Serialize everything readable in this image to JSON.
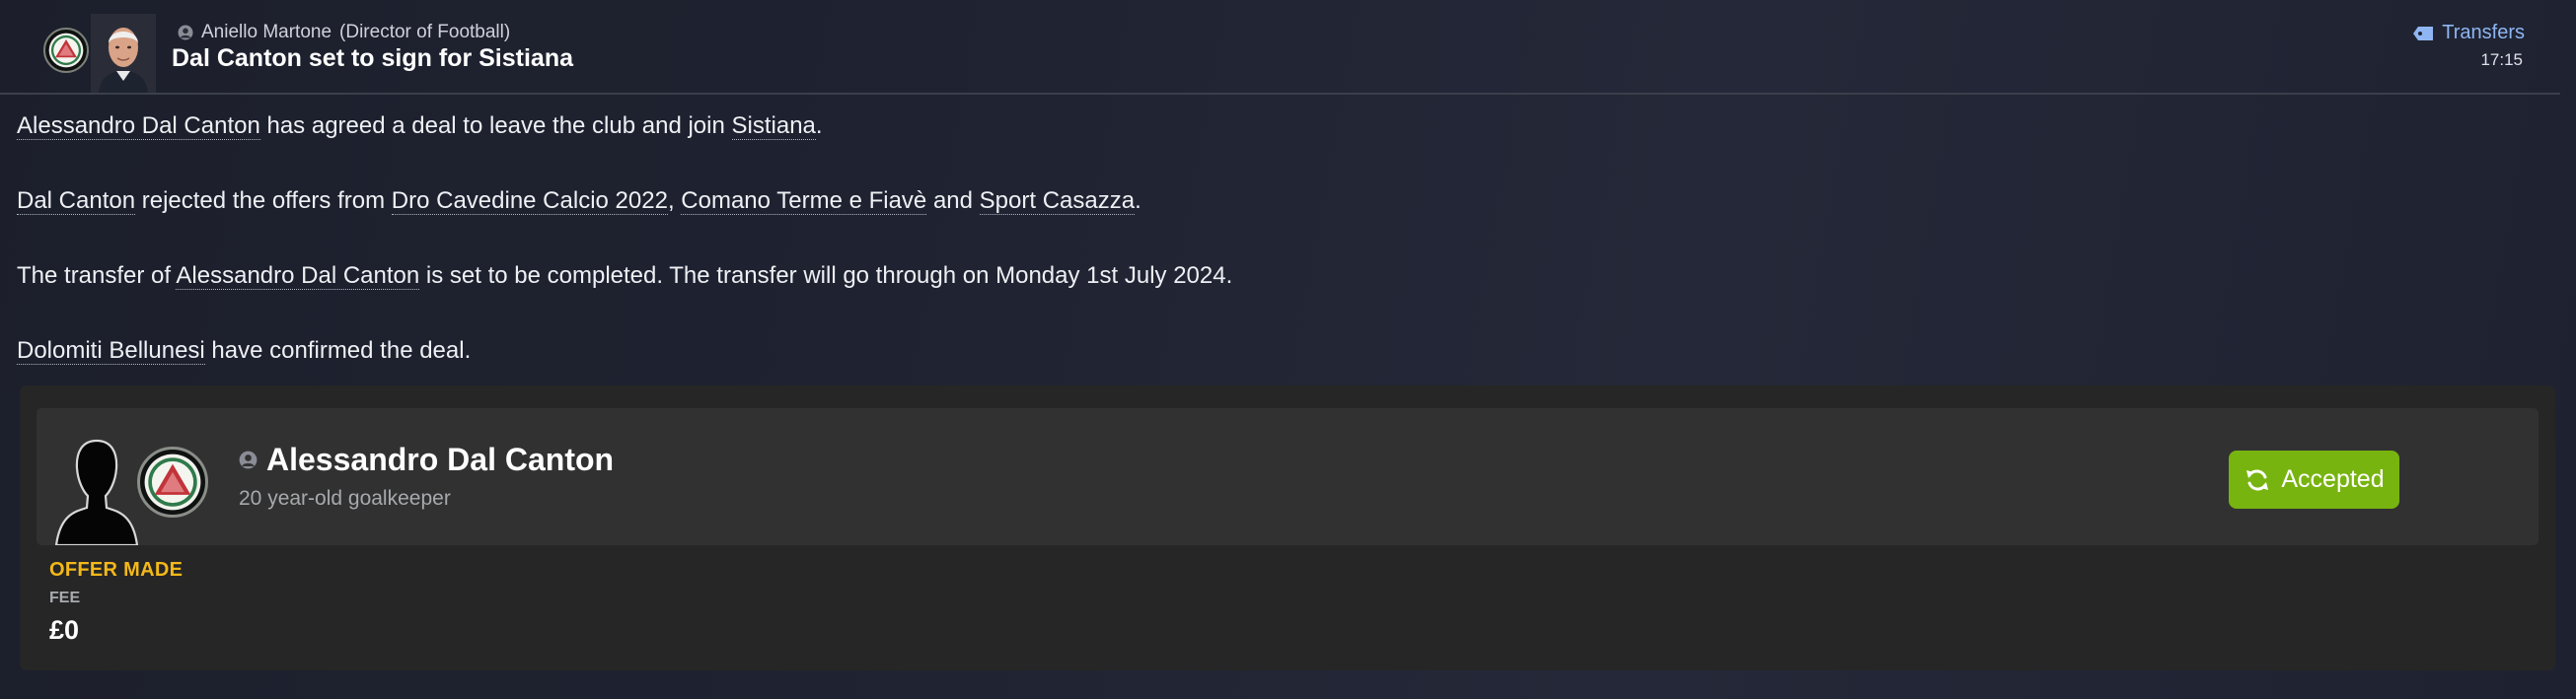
{
  "header": {
    "sender_name": "Aniello Martone",
    "sender_role": "(Director of Football)",
    "headline": "Dal Canton set to sign for Sistiana",
    "category_label": "Transfers",
    "time": "17:15",
    "icons": {
      "club_badge": "club-badge-icon",
      "sender_person": "person-icon",
      "category": "tag-icon"
    }
  },
  "body": {
    "p1": {
      "player": "Alessandro Dal Canton",
      "text_a": " has agreed a deal to leave the club and join ",
      "club": "Sistiana",
      "text_b": "."
    },
    "p2": {
      "player": "Dal Canton",
      "text_a": " rejected the offers from ",
      "club1": "Dro Cavedine Calcio 2022",
      "sep1": ", ",
      "club2": "Comano Terme e Fiavè",
      "sep2": " and ",
      "club3": "Sport Casazza",
      "text_b": "."
    },
    "p3": {
      "text_a": "The transfer of ",
      "player": "Alessandro Dal Canton",
      "text_b": " is set to be completed. The transfer will go through on Monday 1st July 2024."
    },
    "p4": {
      "club": "Dolomiti Bellunesi",
      "text_a": " have confirmed the deal."
    }
  },
  "card": {
    "player_name": "Alessandro Dal Canton",
    "player_desc": "20 year-old goalkeeper",
    "status_label": "Accepted",
    "offer_title": "OFFER MADE",
    "fee_label": "FEE",
    "fee_value": "£0"
  },
  "colors": {
    "background": "#1f2230",
    "accent_link": "#8fb6f2",
    "status_green": "#78b410",
    "offer_title": "#f3b81a",
    "card_bg": "#262626",
    "player_row_bg": "#313131"
  }
}
